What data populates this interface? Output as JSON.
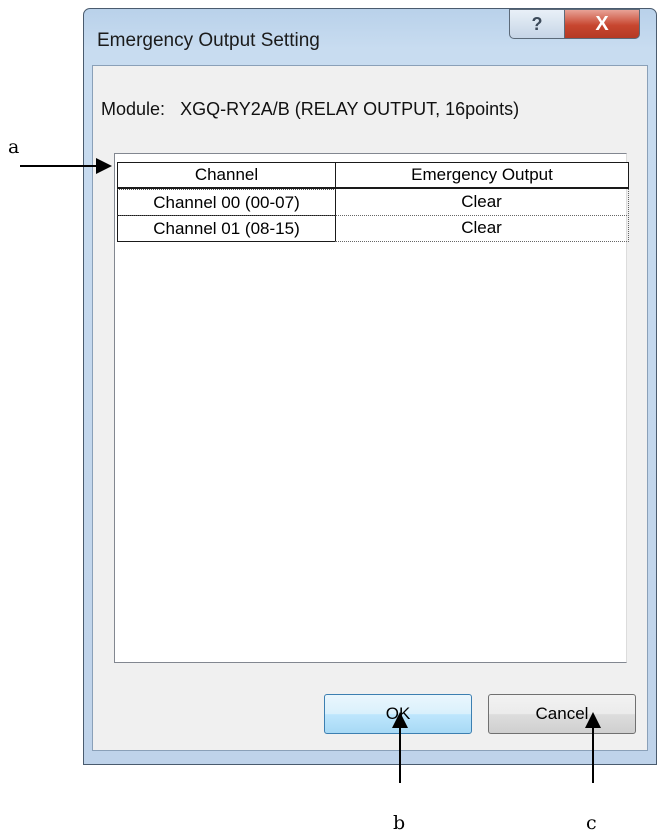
{
  "window": {
    "title": "Emergency Output Setting",
    "help_label": "?",
    "close_label": "X"
  },
  "module": {
    "label": "Module:",
    "value": "XGQ-RY2A/B (RELAY OUTPUT, 16points)"
  },
  "table": {
    "headers": [
      "Channel",
      "Emergency Output"
    ],
    "rows": [
      [
        "Channel 00 (00-07)",
        "Clear"
      ],
      [
        "Channel 01 (08-15)",
        "Clear"
      ]
    ]
  },
  "buttons": {
    "ok": "OK",
    "cancel": "Cancel"
  },
  "annotations": {
    "a": "a",
    "b": "b",
    "c": "c"
  }
}
